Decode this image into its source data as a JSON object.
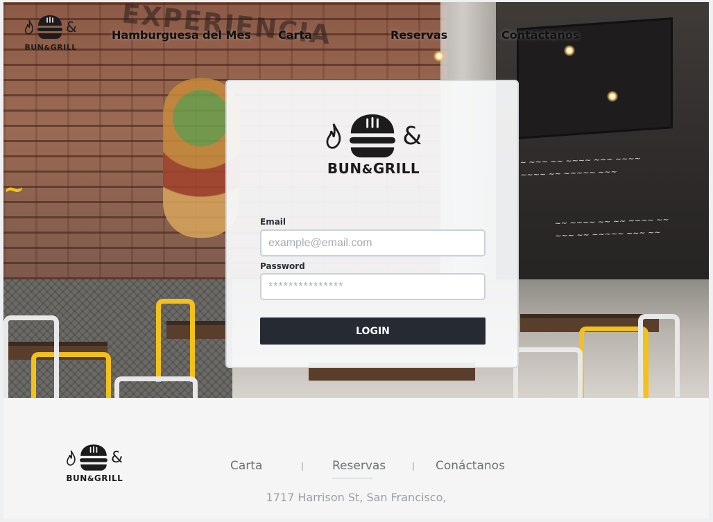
{
  "brand": {
    "name_left": "BUN",
    "ampersand": "&",
    "name_right": "GRILL"
  },
  "nav": {
    "items": [
      {
        "label": "Hamburguesa del Mes"
      },
      {
        "label": "Carta"
      },
      {
        "label": "Reservas"
      },
      {
        "label": "Contáctanos"
      }
    ]
  },
  "login": {
    "email_label": "Email",
    "email_placeholder": "example@email.com",
    "email_value": "",
    "password_label": "Password",
    "password_value": "***************",
    "button_label": "LOGIN"
  },
  "footer": {
    "links": [
      {
        "label": "Carta"
      },
      {
        "label": "Reservas"
      },
      {
        "label": "Conáctanos"
      }
    ],
    "address": "1717 Harrison St, San Francisco,"
  },
  "colors": {
    "button": "#262a33",
    "nav_text": "#111111",
    "footer_text": "#6d7177"
  },
  "icons": [
    "flame-icon",
    "burger-icon",
    "ampersand-icon"
  ]
}
